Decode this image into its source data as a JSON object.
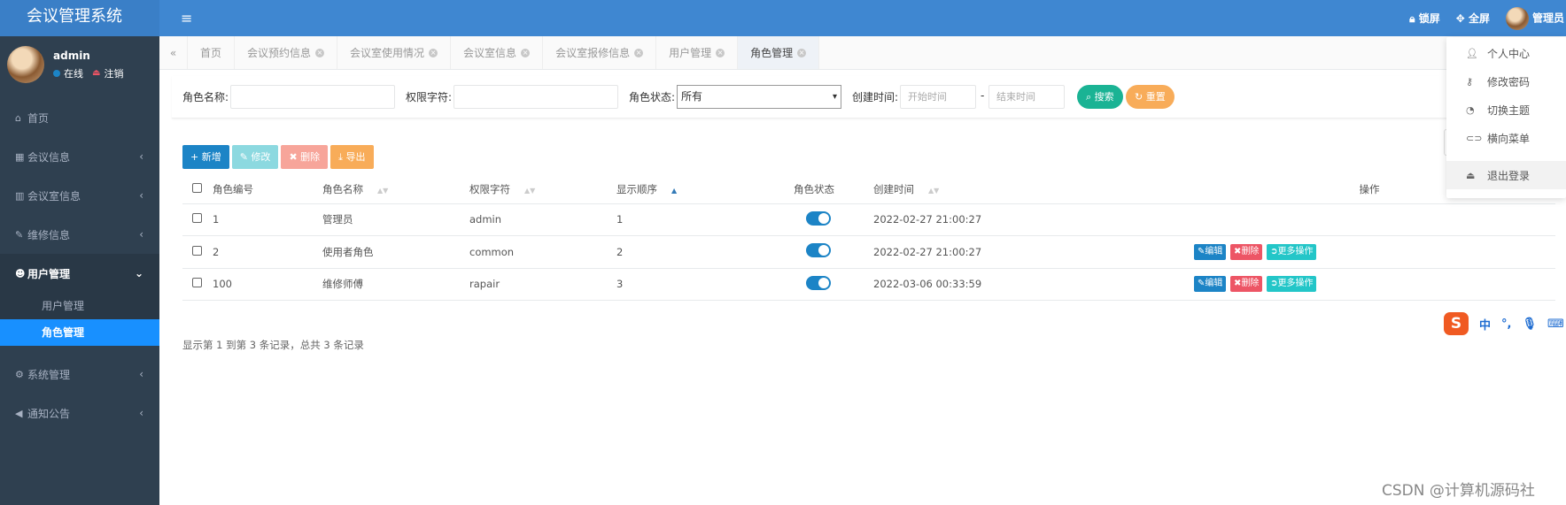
{
  "app": {
    "title": "会议管理系统"
  },
  "user": {
    "name": "admin",
    "status": "在线",
    "logout": "注销"
  },
  "sidebar": {
    "items": [
      {
        "label": "首页",
        "icon": "home-icon"
      },
      {
        "label": "会议信息",
        "icon": "calendar-icon"
      },
      {
        "label": "会议室信息",
        "icon": "bank-icon"
      },
      {
        "label": "维修信息",
        "icon": "wrench-icon"
      },
      {
        "label": "用户管理",
        "icon": "users-icon"
      },
      {
        "label": "系统管理",
        "icon": "gear-icon"
      },
      {
        "label": "通知公告",
        "icon": "volume-icon"
      }
    ],
    "subitems": [
      {
        "label": "用户管理"
      },
      {
        "label": "角色管理"
      }
    ]
  },
  "header": {
    "lock": "锁屏",
    "fullscreen": "全屏",
    "admin": "管理员"
  },
  "tabs": [
    {
      "label": "首页"
    },
    {
      "label": "会议预约信息"
    },
    {
      "label": "会议室使用情况"
    },
    {
      "label": "会议室信息"
    },
    {
      "label": "会议室报修信息"
    },
    {
      "label": "用户管理"
    },
    {
      "label": "角色管理"
    }
  ],
  "search": {
    "role_name_label": "角色名称:",
    "perm_label": "权限字符:",
    "status_label": "角色状态:",
    "status_value": "所有",
    "created_label": "创建时间:",
    "start_placeholder": "开始时间",
    "dash": "-",
    "end_placeholder": "结束时间",
    "search_btn": "搜索",
    "reset_btn": "重置"
  },
  "toolbar": {
    "add": "新增",
    "edit": "修改",
    "delete": "删除",
    "export": "导出"
  },
  "table": {
    "headers": [
      "角色编号",
      "角色名称",
      "权限字符",
      "显示顺序",
      "角色状态",
      "创建时间",
      "操作"
    ],
    "rows": [
      {
        "id": "1",
        "name": "管理员",
        "key": "admin",
        "order": "1",
        "enabled": true,
        "created": "2022-02-27 21:00:27",
        "actions": false
      },
      {
        "id": "2",
        "name": "使用者角色",
        "key": "common",
        "order": "2",
        "enabled": true,
        "created": "2022-02-27 21:00:27",
        "actions": true
      },
      {
        "id": "100",
        "name": "维修师傅",
        "key": "rapair",
        "order": "3",
        "enabled": true,
        "created": "2022-03-06 00:33:59",
        "actions": true
      }
    ],
    "row_actions": {
      "edit": "编辑",
      "delete": "删除",
      "more": "更多操作"
    }
  },
  "pager": {
    "text": "显示第 1 到第 3 条记录，总共 3 条记录"
  },
  "dropdown": [
    {
      "label": "个人中心",
      "icon": "user-icon"
    },
    {
      "label": "修改密码",
      "icon": "key-icon"
    },
    {
      "label": "切换主题",
      "icon": "dashboard-icon"
    },
    {
      "label": "横向菜单",
      "icon": "toggle-icon"
    },
    {
      "label": "退出登录",
      "icon": "sign-out-icon"
    }
  ],
  "ime": {
    "logo": "S",
    "lang": "中",
    "punct": "°,"
  },
  "watermark": "CSDN @计算机源码社",
  "colors": {
    "header": "#3f87d1",
    "sidebar": "#2f4050",
    "active": "#1890ff",
    "primary": "#1c84c6",
    "danger": "#ed5565",
    "info": "#23c6c8",
    "warning": "#f8ac59"
  }
}
